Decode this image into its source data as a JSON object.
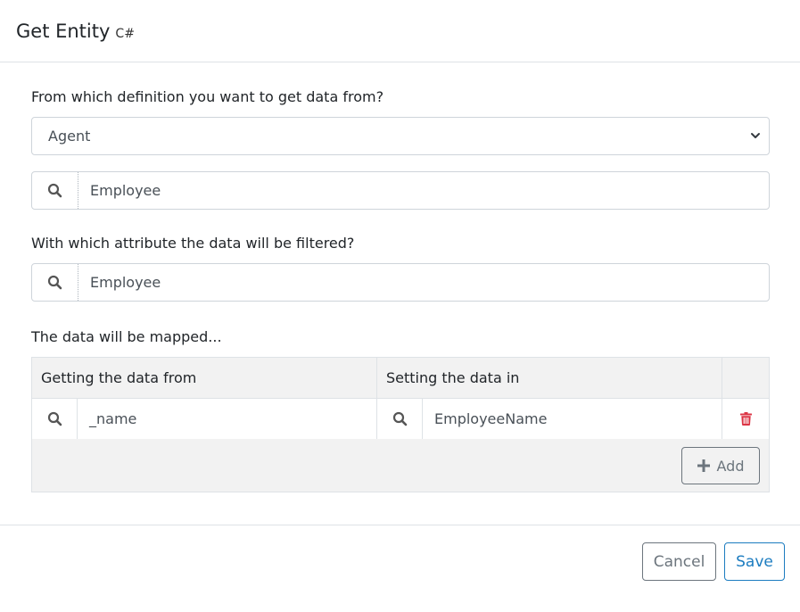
{
  "header": {
    "title": "Get Entity",
    "subtitle": "C#"
  },
  "definition": {
    "label": "From which definition you want to get data from?",
    "selected": "Agent",
    "search_value": "Employee"
  },
  "filter": {
    "label": "With which attribute the data will be filtered?",
    "search_value": "Employee"
  },
  "mapping": {
    "label": "The data will be mapped...",
    "columns": [
      "Getting the data from",
      "Setting the data in"
    ],
    "rows": [
      {
        "from": "_name",
        "to": "EmployeeName"
      }
    ],
    "add_label": "Add"
  },
  "footer": {
    "cancel_label": "Cancel",
    "save_label": "Save"
  },
  "colors": {
    "primary": "#1c7cc0",
    "danger": "#dc3545",
    "secondary": "#6c757d"
  },
  "icons": [
    "search-icon",
    "chevron-down-icon",
    "trash-icon",
    "plus-icon"
  ]
}
